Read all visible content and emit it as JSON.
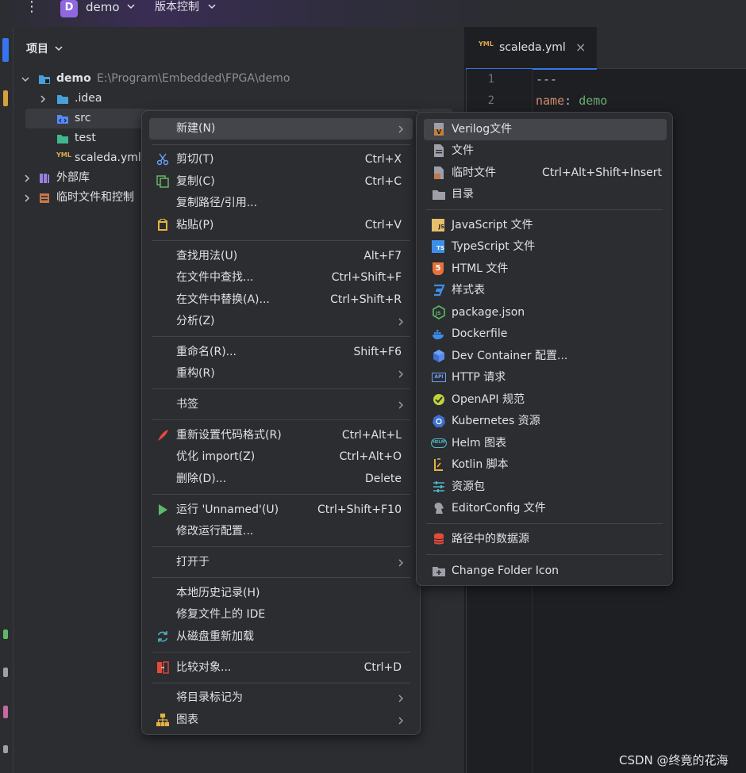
{
  "titlebar": {
    "project_badge": "D",
    "project_name": "demo",
    "vcs_label": "版本控制"
  },
  "project_panel": {
    "title": "项目",
    "tree": [
      {
        "label": "demo",
        "path": "E:\\Program\\Embedded\\FPGA\\demo"
      },
      {
        "label": ".idea"
      },
      {
        "label": "src"
      },
      {
        "label": "test"
      },
      {
        "label": "scaleda.yml"
      },
      {
        "label": "外部库"
      },
      {
        "label": "临时文件和控制"
      }
    ]
  },
  "editor": {
    "tab_label": "scaleda.yml",
    "tab_close": "×",
    "lines": [
      {
        "num": "1",
        "text": "---"
      },
      {
        "num": "2",
        "key": "name",
        "sep": ": ",
        "value": "demo"
      }
    ]
  },
  "context_menu": {
    "items": [
      {
        "label": "新建(N)"
      },
      {
        "label": "剪切(T)",
        "shortcut": "Ctrl+X"
      },
      {
        "label": "复制(C)",
        "shortcut": "Ctrl+C"
      },
      {
        "label": "复制路径/引用..."
      },
      {
        "label": "粘贴(P)",
        "shortcut": "Ctrl+V"
      },
      {
        "label": "查找用法(U)",
        "shortcut": "Alt+F7"
      },
      {
        "label": "在文件中查找...",
        "shortcut": "Ctrl+Shift+F"
      },
      {
        "label": "在文件中替换(A)...",
        "shortcut": "Ctrl+Shift+R"
      },
      {
        "label": "分析(Z)"
      },
      {
        "label": "重命名(R)...",
        "shortcut": "Shift+F6"
      },
      {
        "label": "重构(R)"
      },
      {
        "label": "书签"
      },
      {
        "label": "重新设置代码格式(R)",
        "shortcut": "Ctrl+Alt+L"
      },
      {
        "label": "优化 import(Z)",
        "shortcut": "Ctrl+Alt+O"
      },
      {
        "label": "删除(D)...",
        "shortcut": "Delete"
      },
      {
        "label": "运行 'Unnamed'(U)",
        "shortcut": "Ctrl+Shift+F10"
      },
      {
        "label": "修改运行配置..."
      },
      {
        "label": "打开于"
      },
      {
        "label": "本地历史记录(H)"
      },
      {
        "label": "修复文件上的 IDE"
      },
      {
        "label": "从磁盘重新加载"
      },
      {
        "label": "比较对象...",
        "shortcut": "Ctrl+D"
      },
      {
        "label": "将目录标记为"
      },
      {
        "label": "图表"
      }
    ]
  },
  "new_submenu": {
    "items": [
      {
        "label": "Verilog文件"
      },
      {
        "label": "文件"
      },
      {
        "label": "临时文件",
        "shortcut": "Ctrl+Alt+Shift+Insert"
      },
      {
        "label": "目录"
      },
      {
        "label": "JavaScript 文件"
      },
      {
        "label": "TypeScript 文件"
      },
      {
        "label": "HTML 文件"
      },
      {
        "label": "样式表"
      },
      {
        "label": "package.json"
      },
      {
        "label": "Dockerfile"
      },
      {
        "label": "Dev Container 配置..."
      },
      {
        "label": "HTTP 请求"
      },
      {
        "label": "OpenAPI 规范"
      },
      {
        "label": "Kubernetes 资源"
      },
      {
        "label": "Helm 图表"
      },
      {
        "label": "Kotlin 脚本"
      },
      {
        "label": "资源包"
      },
      {
        "label": "EditorConfig 文件"
      },
      {
        "label": "路径中的数据源"
      },
      {
        "label": "Change Folder Icon"
      }
    ]
  },
  "icon_text": {
    "js": "JS",
    "ts": "TS",
    "html5": "5",
    "api": "API",
    "helm": "HELM",
    "yml": "YML",
    "v": "V"
  },
  "watermark": "CSDN @终竟的花海",
  "colors": {
    "accent": "#3574f0",
    "selection": "#2e436e",
    "menu_bg": "#2b2d30",
    "keyword": "#cf8e6d",
    "value": "#6aab73"
  }
}
